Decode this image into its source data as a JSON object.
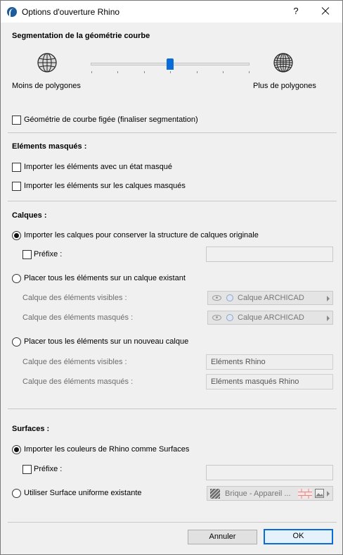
{
  "window": {
    "title": "Options d'ouverture Rhino",
    "help_label": "?"
  },
  "segmentation": {
    "heading": "Segmentation de la géométrie courbe",
    "left_label": "Moins de polygones",
    "right_label": "Plus de polygones",
    "slider_level": 0.5,
    "left_icon": "globe-icon",
    "right_icon": "globe-icon",
    "frozen_label": "Géométrie de courbe figée (finaliser segmentation)",
    "frozen_checked": false
  },
  "hidden": {
    "heading": "Eléments masqués :",
    "import_hidden_state": "Importer les éléments avec un état masqué",
    "import_hidden_layers": "Importer les éléments sur les calques masqués"
  },
  "layers": {
    "heading": "Calques :",
    "option1": "Importer les calques pour conserver la structure de calques originale",
    "prefix_label": "Préfixe :",
    "prefix_value": "",
    "option2": "Placer tous les éléments sur un calque existant",
    "visible_label": "Calque des éléments visibles :",
    "hidden_label": "Calque des éléments masqués :",
    "visible_combo": "Calque ARCHICAD",
    "hidden_combo": "Calque ARCHICAD",
    "option3": "Placer tous les éléments sur un nouveau calque",
    "visible_label2": "Calque des éléments visibles :",
    "hidden_label2": "Calque des éléments masqués :",
    "new_visible_value": "Eléments Rhino",
    "new_hidden_value": "Eléments masqués Rhino",
    "selected_option": 1
  },
  "surfaces": {
    "heading": "Surfaces :",
    "option1": "Importer les couleurs de Rhino comme Surfaces",
    "prefix_label": "Préfixe :",
    "prefix_value": "",
    "option2": "Utiliser Surface uniforme existante",
    "surface_value": "Brique - Appareil ...",
    "selected_option": 1
  },
  "buttons": {
    "cancel": "Annuler",
    "ok": "OK"
  },
  "colors": {
    "accent": "#0a6cd8",
    "window_bg": "#f0f0f0"
  }
}
